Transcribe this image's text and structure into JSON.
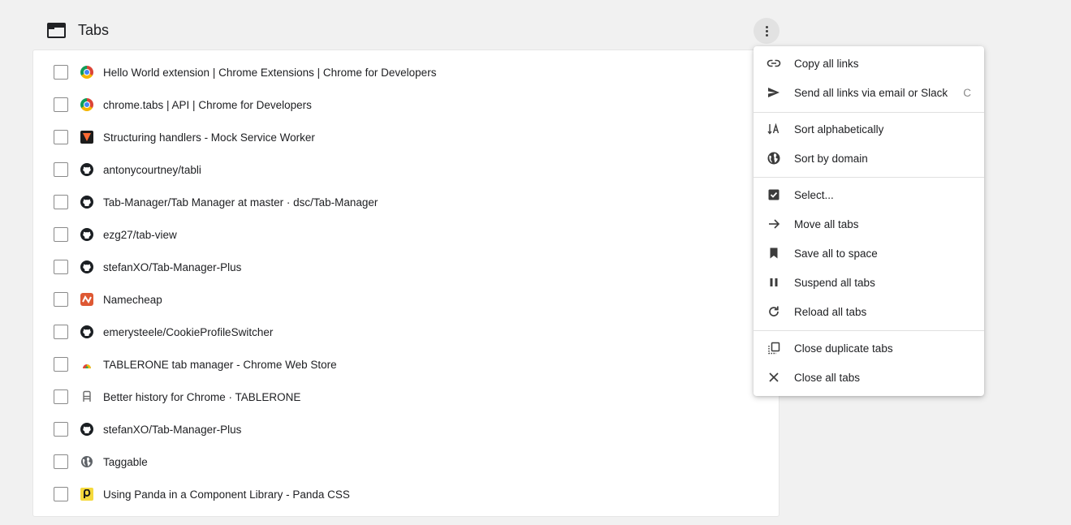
{
  "header": {
    "title": "Tabs"
  },
  "tabs": [
    {
      "title": "Hello World extension  |  Chrome Extensions  |  Chrome for Developers",
      "favicon": "chrome-icon"
    },
    {
      "title": "chrome.tabs  |  API  |  Chrome for Developers",
      "favicon": "chrome-icon"
    },
    {
      "title": "Structuring handlers - Mock Service Worker",
      "favicon": "msw-icon"
    },
    {
      "title": "antonycourtney/tabli",
      "favicon": "github-icon"
    },
    {
      "title": "Tab-Manager/Tab Manager at master · dsc/Tab-Manager",
      "favicon": "github-icon"
    },
    {
      "title": "ezg27/tab-view",
      "favicon": "github-icon"
    },
    {
      "title": "stefanXO/Tab-Manager-Plus",
      "favicon": "github-icon"
    },
    {
      "title": "Namecheap",
      "favicon": "namecheap-icon"
    },
    {
      "title": "emerysteele/CookieProfileSwitcher",
      "favicon": "github-icon"
    },
    {
      "title": "TABLERONE tab manager - Chrome Web Store",
      "favicon": "tablerone-icon"
    },
    {
      "title": "Better history for Chrome · TABLERONE",
      "favicon": "chair-icon"
    },
    {
      "title": "stefanXO/Tab-Manager-Plus",
      "favicon": "github-icon"
    },
    {
      "title": "Taggable",
      "favicon": "globe-icon"
    },
    {
      "title": "Using Panda in a Component Library - Panda CSS",
      "favicon": "panda-icon"
    }
  ],
  "menu": {
    "copy_links": "Copy all links",
    "send_links": "Send all links via email or Slack",
    "send_links_shortcut": "C",
    "sort_alpha": "Sort alphabetically",
    "sort_domain": "Sort by domain",
    "select": "Select...",
    "move_all": "Move all tabs",
    "save_space": "Save all to space",
    "suspend_all": "Suspend all tabs",
    "reload_all": "Reload all tabs",
    "close_duplicates": "Close duplicate tabs",
    "close_all": "Close all tabs"
  },
  "colors": {
    "background": "#f1f1f1",
    "panel": "#ffffff",
    "text": "#202124"
  }
}
